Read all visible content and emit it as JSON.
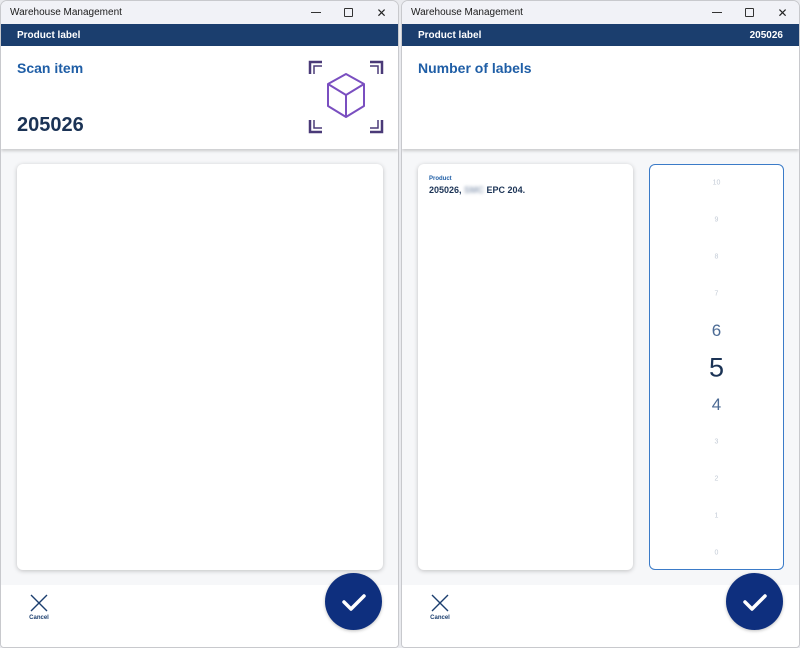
{
  "windows": [
    {
      "title": "Warehouse Management",
      "appbar": {
        "title": "Product label",
        "right": ""
      },
      "header": {
        "title": "Scan item",
        "value": "205026",
        "icon": "scan-box-icon"
      },
      "footer": {
        "cancel_label": "Cancel",
        "confirm_icon": "checkmark-icon"
      }
    },
    {
      "title": "Warehouse Management",
      "appbar": {
        "title": "Product label",
        "right": "205026"
      },
      "header": {
        "title": "Number of labels"
      },
      "product": {
        "label": "Product",
        "value_prefix": "205026, ",
        "value_redacted": "SMC",
        "value_suffix": " EPC 204."
      },
      "picker": {
        "values": [
          "10",
          "9",
          "8",
          "7",
          "6",
          "5",
          "4",
          "3",
          "2",
          "1",
          "0"
        ],
        "selected": "5"
      },
      "footer": {
        "cancel_label": "Cancel",
        "confirm_icon": "checkmark-icon"
      }
    }
  ],
  "colors": {
    "appbar": "#1b3e6e",
    "accent": "#1f5ea6",
    "confirm": "#0e2f7e",
    "scan_icon": "#7a4fc0"
  }
}
